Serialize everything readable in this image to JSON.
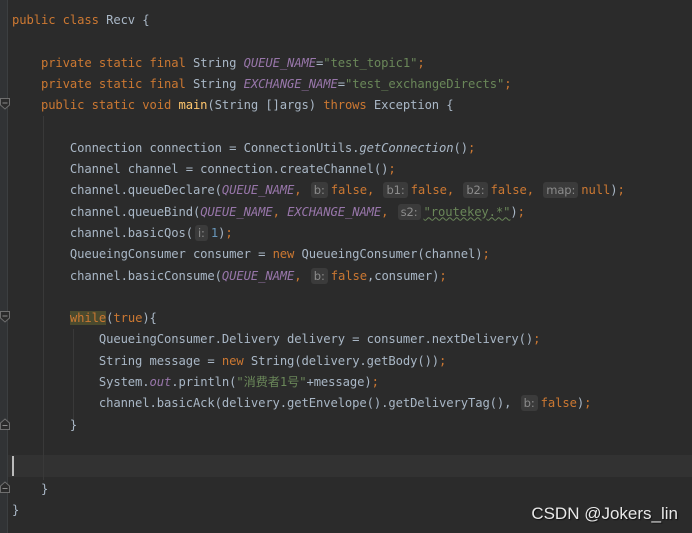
{
  "editor": {
    "class_decl": {
      "kw": "public class ",
      "name": "Recv",
      "brace": " {"
    },
    "field1": {
      "mods": "private static final ",
      "type": "String ",
      "name": "QUEUE_NAME",
      "eq": "=",
      "value": "\"test_topic1\"",
      "semi": ";"
    },
    "field2": {
      "mods": "private static final ",
      "type": "String ",
      "name": "EXCHANGE_NAME",
      "eq": "=",
      "value": "\"test_exchangeDirects\"",
      "semi": ";"
    },
    "main_decl": {
      "mods": "public static void ",
      "name": "main",
      "params": "(String []args) ",
      "throws": "throws",
      "rest": " Exception {"
    },
    "l_conn": {
      "a": "Connection connection = ConnectionUtils.",
      "b": "getConnection",
      "c": "()",
      "semi": ";"
    },
    "l_chan": {
      "a": "Channel channel = connection.createChannel()",
      "semi": ";"
    },
    "l_qdecl": {
      "a": "channel.queueDeclare(",
      "c1": "QUEUE_NAME",
      "s1": ", ",
      "h1": "b:",
      "v1": "false",
      "s2": ", ",
      "h2": "b1:",
      "v2": "false",
      "s3": ", ",
      "h3": "b2:",
      "v3": "false",
      "s4": ", ",
      "h4": "map:",
      "v4": "null",
      "end": ")",
      "semi": ";"
    },
    "l_qbind": {
      "a": "channel.queueBind(",
      "c1": "QUEUE_NAME",
      "s1": ", ",
      "c2": "EXCHANGE_NAME",
      "s2": ", ",
      "h1": "s2:",
      "v1": "\"routekey.*\"",
      "end": ")",
      "semi": ";"
    },
    "l_qos": {
      "a": "channel.basicQos(",
      "h1": "i:",
      "v1": "1",
      "end": ")",
      "semi": ";"
    },
    "l_consumer": {
      "a": "QueueingConsumer consumer = ",
      "new": "new",
      "b": " QueueingConsumer(channel)",
      "semi": ";"
    },
    "l_consume": {
      "a": "channel.basicConsume(",
      "c1": "QUEUE_NAME",
      "s1": ", ",
      "h1": "b:",
      "v1": "false",
      "b": ",consumer)",
      "semi": ";"
    },
    "l_while": {
      "kw": "while",
      "p1": "(",
      "t": "true",
      "p2": "){"
    },
    "l_delivery": {
      "a": "QueueingConsumer.Delivery delivery = consumer.nextDelivery()",
      "semi": ";"
    },
    "l_message": {
      "a": "String message = ",
      "new": "new",
      "b": " String(delivery.getBody())",
      "semi": ";"
    },
    "l_print": {
      "a": "System.",
      "out": "out",
      "b": ".println(",
      "str": "\"消费者1号\"",
      "c": "+message)",
      "semi": ";"
    },
    "l_ack": {
      "a": "channel.basicAck(delivery.getEnvelope().getDeliveryTag(), ",
      "h1": "b:",
      "v1": "false",
      "end": ")",
      "semi": ";"
    },
    "close_while": "}",
    "close_main": "}",
    "close_class": "}"
  },
  "watermark": "CSDN @Jokers_lin"
}
